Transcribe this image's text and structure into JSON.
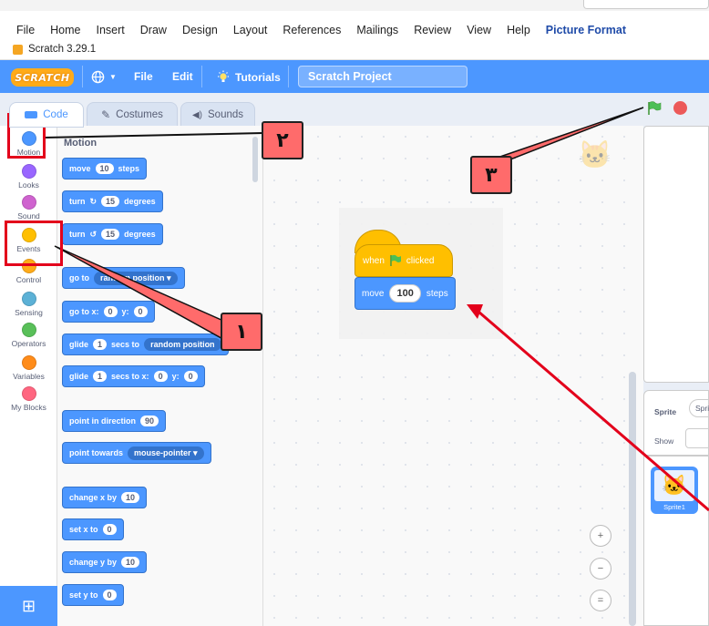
{
  "word": {
    "menu": [
      "File",
      "Home",
      "Insert",
      "Draw",
      "Design",
      "Layout",
      "References",
      "Mailings",
      "Review",
      "View",
      "Help",
      "Picture Format"
    ]
  },
  "app": {
    "title": "Scratch 3.29.1"
  },
  "menubar": {
    "logo": "SCRATCH",
    "language_icon": "globe-icon",
    "file": "File",
    "edit": "Edit",
    "tutorials": "Tutorials",
    "project_title": "Scratch Project"
  },
  "tabs": {
    "code": "Code",
    "costumes": "Costumes",
    "sounds": "Sounds"
  },
  "categories": [
    {
      "label": "Motion",
      "color": "#4c97ff"
    },
    {
      "label": "Looks",
      "color": "#9966ff"
    },
    {
      "label": "Sound",
      "color": "#cf63cf"
    },
    {
      "label": "Events",
      "color": "#ffbf00"
    },
    {
      "label": "Control",
      "color": "#ffab19"
    },
    {
      "label": "Sensing",
      "color": "#5cb1d6"
    },
    {
      "label": "Operators",
      "color": "#59c059"
    },
    {
      "label": "Variables",
      "color": "#ff8c1a"
    },
    {
      "label": "My Blocks",
      "color": "#ff6680"
    }
  ],
  "palette": {
    "header": "Motion",
    "move": {
      "a": "move",
      "n": "10",
      "b": "steps"
    },
    "turn_right": {
      "a": "turn",
      "n": "15",
      "b": "degrees"
    },
    "turn_left": {
      "a": "turn",
      "n": "15",
      "b": "degrees"
    },
    "goto": {
      "a": "go to",
      "dd": "random position"
    },
    "goto_xy": {
      "a": "go to x:",
      "x": "0",
      "y_label": "y:",
      "y": "0"
    },
    "glide_random": {
      "a": "glide",
      "n": "1",
      "b": "secs to",
      "dd": "random position"
    },
    "glide_xy": {
      "a": "glide",
      "n": "1",
      "b": "secs to x:",
      "x": "0",
      "y_label": "y:",
      "y": "0"
    },
    "point_dir": {
      "a": "point in direction",
      "n": "90"
    },
    "point_towards": {
      "a": "point towards",
      "dd": "mouse-pointer"
    },
    "change_x": {
      "a": "change x by",
      "n": "10"
    },
    "set_x": {
      "a": "set x to",
      "n": "0"
    },
    "change_y": {
      "a": "change y by",
      "n": "10"
    },
    "set_y": {
      "a": "set y to",
      "n": "0"
    }
  },
  "script": {
    "hat": {
      "a": "when",
      "b": "clicked"
    },
    "motion": {
      "a": "move",
      "n": "100",
      "b": "steps"
    }
  },
  "zoom": {
    "in": "+",
    "out": "−",
    "reset": "="
  },
  "sprite_pane": {
    "sprite_label": "Sprite",
    "sprite_name": "Sprite1",
    "show_label": "Show",
    "thumb_name": "Sprite1"
  },
  "callouts": {
    "one": "١",
    "two": "٢",
    "three": "٣"
  },
  "colors": {
    "scratch_blue": "#4c97ff",
    "event_yellow": "#ffbf00",
    "annotation_red": "#e3001b"
  }
}
